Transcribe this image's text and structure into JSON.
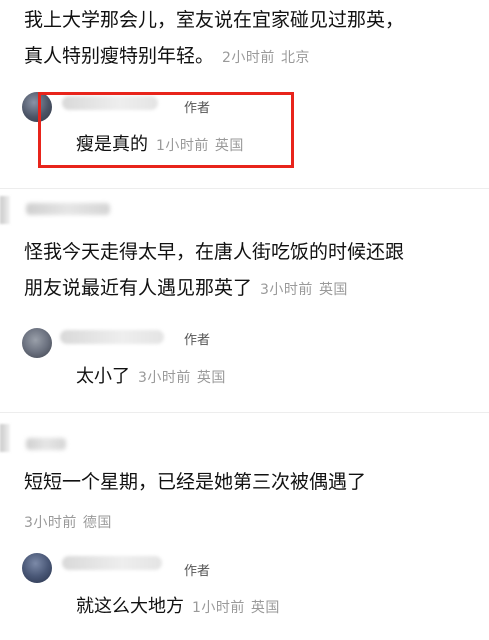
{
  "comments": [
    {
      "text_lines": [
        "我上大学那会儿，室友说在宜家碰见过那英，",
        "真人特别瘦特别年轻。"
      ],
      "time": "2小时前",
      "location": "北京",
      "reply": {
        "tag": "作者",
        "text": "瘦是真的",
        "time": "1小时前",
        "location": "英国"
      }
    },
    {
      "text_lines": [
        "怪我今天走得太早，在唐人街吃饭的时候还跟",
        "朋友说最近有人遇见那英了"
      ],
      "time": "3小时前",
      "location": "英国",
      "reply": {
        "tag": "作者",
        "text": "太小了",
        "time": "3小时前",
        "location": "英国"
      }
    },
    {
      "text_lines": [
        "短短一个星期，已经是她第三次被偶遇了"
      ],
      "time": "3小时前",
      "location": "德国",
      "reply": {
        "tag": "作者",
        "text": "就这么大地方",
        "time": "1小时前",
        "location": "英国"
      }
    }
  ],
  "colors": {
    "text": "#111111",
    "meta": "#9a9a9a",
    "highlight": "#e8241b",
    "separator": "#ededed"
  },
  "icons": {
    "avatar": "user-avatar-icon"
  }
}
